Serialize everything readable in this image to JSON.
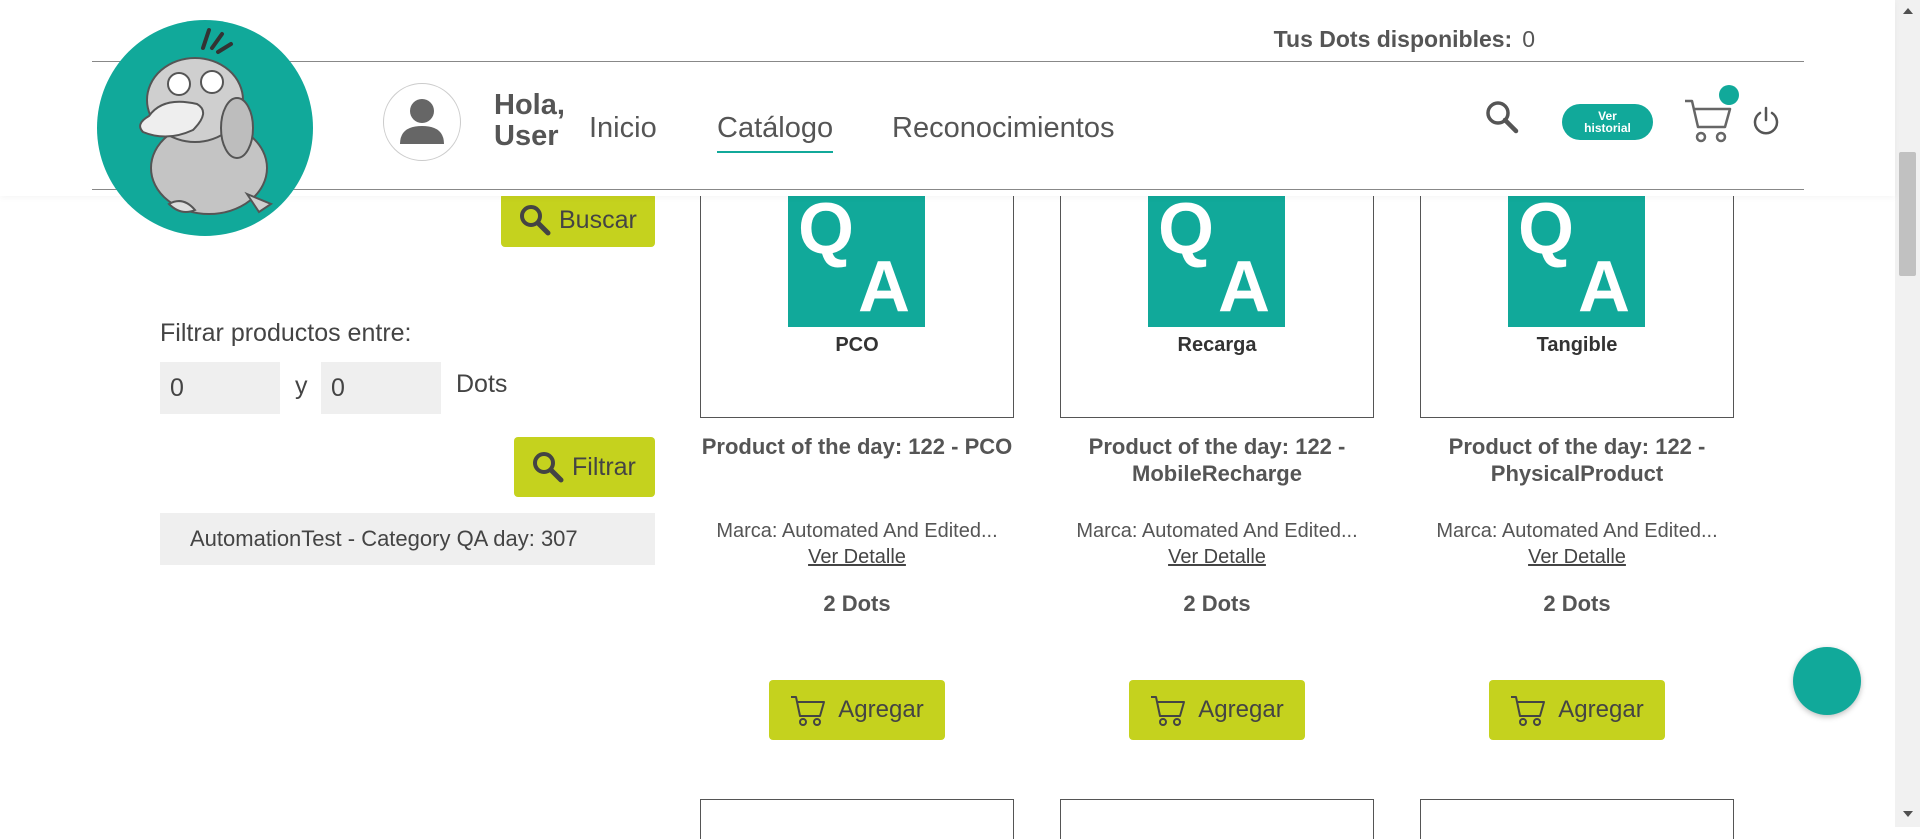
{
  "header": {
    "dots_label": "Tus Dots disponibles:",
    "dots_value": "0",
    "greeting_line1": "Hola,",
    "greeting_line2": "User",
    "nav": [
      "Inicio",
      "Catálogo",
      "Reconocimientos"
    ],
    "active_nav": "Catálogo",
    "historial_line1": "Ver",
    "historial_line2": "historial"
  },
  "sidebar": {
    "search_button": "Buscar",
    "filter_label": "Filtrar productos entre:",
    "min_value": "0",
    "max_value": "0",
    "between_word": "y",
    "unit": "Dots",
    "filter_button": "Filtrar",
    "category": "AutomationTest - Category QA day: 307"
  },
  "products": [
    {
      "image_text_q": "Q",
      "image_text_a": "A",
      "type": "PCO",
      "title_line1": "Product of the day: 122 - PCO",
      "title_line2": "",
      "brand": "Marca: Automated And Edited...",
      "detail": "Ver Detalle",
      "price": "2 Dots",
      "add": "Agregar"
    },
    {
      "image_text_q": "Q",
      "image_text_a": "A",
      "type": "Recarga",
      "title_line1": "Product of the day: 122 -",
      "title_line2": "MobileRecharge",
      "brand": "Marca: Automated And Edited...",
      "detail": "Ver Detalle",
      "price": "2 Dots",
      "add": "Agregar"
    },
    {
      "image_text_q": "Q",
      "image_text_a": "A",
      "type": "Tangible",
      "title_line1": "Product of the day: 122 -",
      "title_line2": "PhysicalProduct",
      "brand": "Marca: Automated And Edited...",
      "detail": "Ver Detalle",
      "price": "2 Dots",
      "add": "Agregar"
    }
  ],
  "fab": {
    "icon": "chat-icon",
    "glyph": ""
  },
  "colors": {
    "teal": "#11a99a",
    "lime": "#c5d21e",
    "text": "#444444"
  }
}
